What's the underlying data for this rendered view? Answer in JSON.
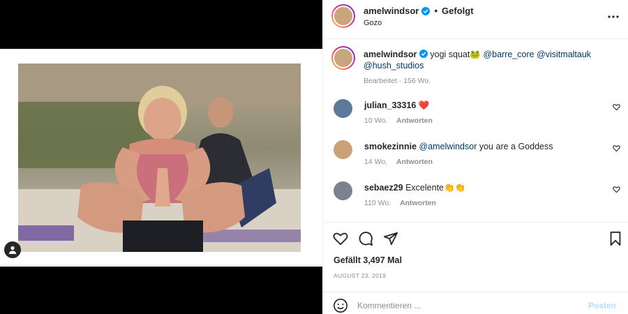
{
  "post": {
    "username": "amelwindsor",
    "separator": "•",
    "follow_status": "Gefolgt",
    "location": "Gozo"
  },
  "caption": {
    "username": "amelwindsor",
    "text": "yogi squat",
    "emoji": "🐸",
    "mentions": [
      "@barre_core",
      "@visitmaltauk",
      "@hush_studios"
    ],
    "edited_label": "Bearbeitet",
    "age": "156 Wo."
  },
  "comments": [
    {
      "username": "julian_33316",
      "mention": "",
      "text": "",
      "emoji": "❤️",
      "age": "10 Wo.",
      "reply_label": "Antworten",
      "avatar_color": "#5b7a99"
    },
    {
      "username": "smokezinnie",
      "mention": "@amelwindsor",
      "text": "you are a Goddess",
      "emoji": "",
      "age": "14 Wo.",
      "reply_label": "Antworten",
      "avatar_color": "#c9a27a"
    },
    {
      "username": "sebaez29",
      "mention": "",
      "text": "Excelente",
      "emoji": "👏👏",
      "age": "110 Wo.",
      "reply_label": "Antworten",
      "avatar_color": "#7a8290"
    }
  ],
  "likes_text": "Gefällt 3,497 Mal",
  "date_text": "AUGUST 23, 2019",
  "composer": {
    "placeholder": "Kommentieren ...",
    "post_label": "Posten"
  },
  "icons": {
    "verified": "verified-badge-icon",
    "more": "more-options-icon",
    "like": "heart-icon",
    "comment": "comment-bubble-icon",
    "share": "paper-plane-icon",
    "save": "bookmark-icon",
    "emoji": "smiley-icon",
    "user_tags": "user-tag-icon"
  },
  "colors": {
    "verified_blue": "#0095f6",
    "mention_blue": "#00376b",
    "post_button_disabled": "#b2dffc",
    "like_red": "#ed4956"
  }
}
